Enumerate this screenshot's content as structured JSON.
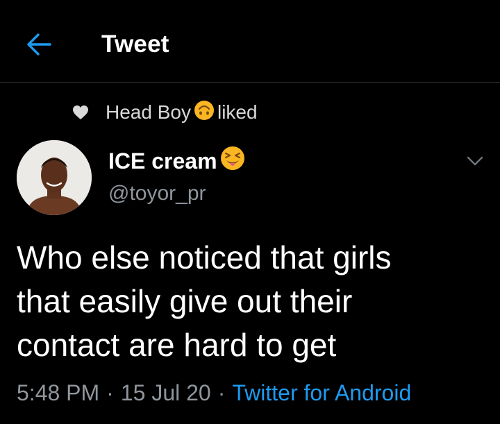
{
  "header": {
    "title": "Tweet",
    "back_icon": "arrow-left-icon",
    "accent_color": "#1d9bf0"
  },
  "social_context": {
    "icon": "heart-icon",
    "user": "Head Boy",
    "user_emoji": "upside-down-face-emoji",
    "action": "liked"
  },
  "tweet": {
    "author_name": "ICE cream",
    "author_emoji": "squinting-face-with-tongue-emoji",
    "author_handle": "@toyor_pr",
    "more_icon": "chevron-down-icon",
    "lines": [
      "Who else noticed that girls",
      "that easily give out their",
      "contact are hard to get"
    ],
    "time": "5:48 PM",
    "separator": "·",
    "date": "15 Jul 20",
    "source": "Twitter for Android"
  }
}
